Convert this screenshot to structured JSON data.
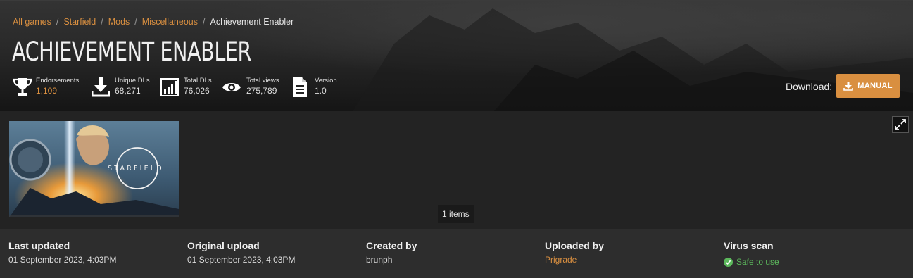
{
  "breadcrumb": {
    "items": [
      "All games",
      "Starfield",
      "Mods",
      "Miscellaneous"
    ],
    "current": "Achievement Enabler"
  },
  "mod": {
    "title": "ACHIEVEMENT ENABLER"
  },
  "stats": [
    {
      "label": "Endorsements",
      "value": "1,109",
      "icon": "trophy-icon"
    },
    {
      "label": "Unique DLs",
      "value": "68,271",
      "icon": "download-icon"
    },
    {
      "label": "Total DLs",
      "value": "76,026",
      "icon": "bar-chart-icon"
    },
    {
      "label": "Total views",
      "value": "275,789",
      "icon": "eye-icon"
    },
    {
      "label": "Version",
      "value": "1.0",
      "icon": "document-icon"
    }
  ],
  "download": {
    "label": "Download:",
    "button": "MANUAL"
  },
  "gallery": {
    "count_text": "1 items",
    "thumbnail_text": "STARFIELD"
  },
  "info": {
    "last_updated": {
      "heading": "Last updated",
      "value": "01 September 2023,  4:03PM"
    },
    "original_upload": {
      "heading": "Original upload",
      "value": "01 September 2023,  4:03PM"
    },
    "created_by": {
      "heading": "Created by",
      "value": "brunph"
    },
    "uploaded_by": {
      "heading": "Uploaded by",
      "value": "Prigrade"
    },
    "virus_scan": {
      "heading": "Virus scan",
      "value": "Safe to use"
    }
  },
  "colors": {
    "accent": "#d98f40",
    "safe": "#5cb85c"
  }
}
